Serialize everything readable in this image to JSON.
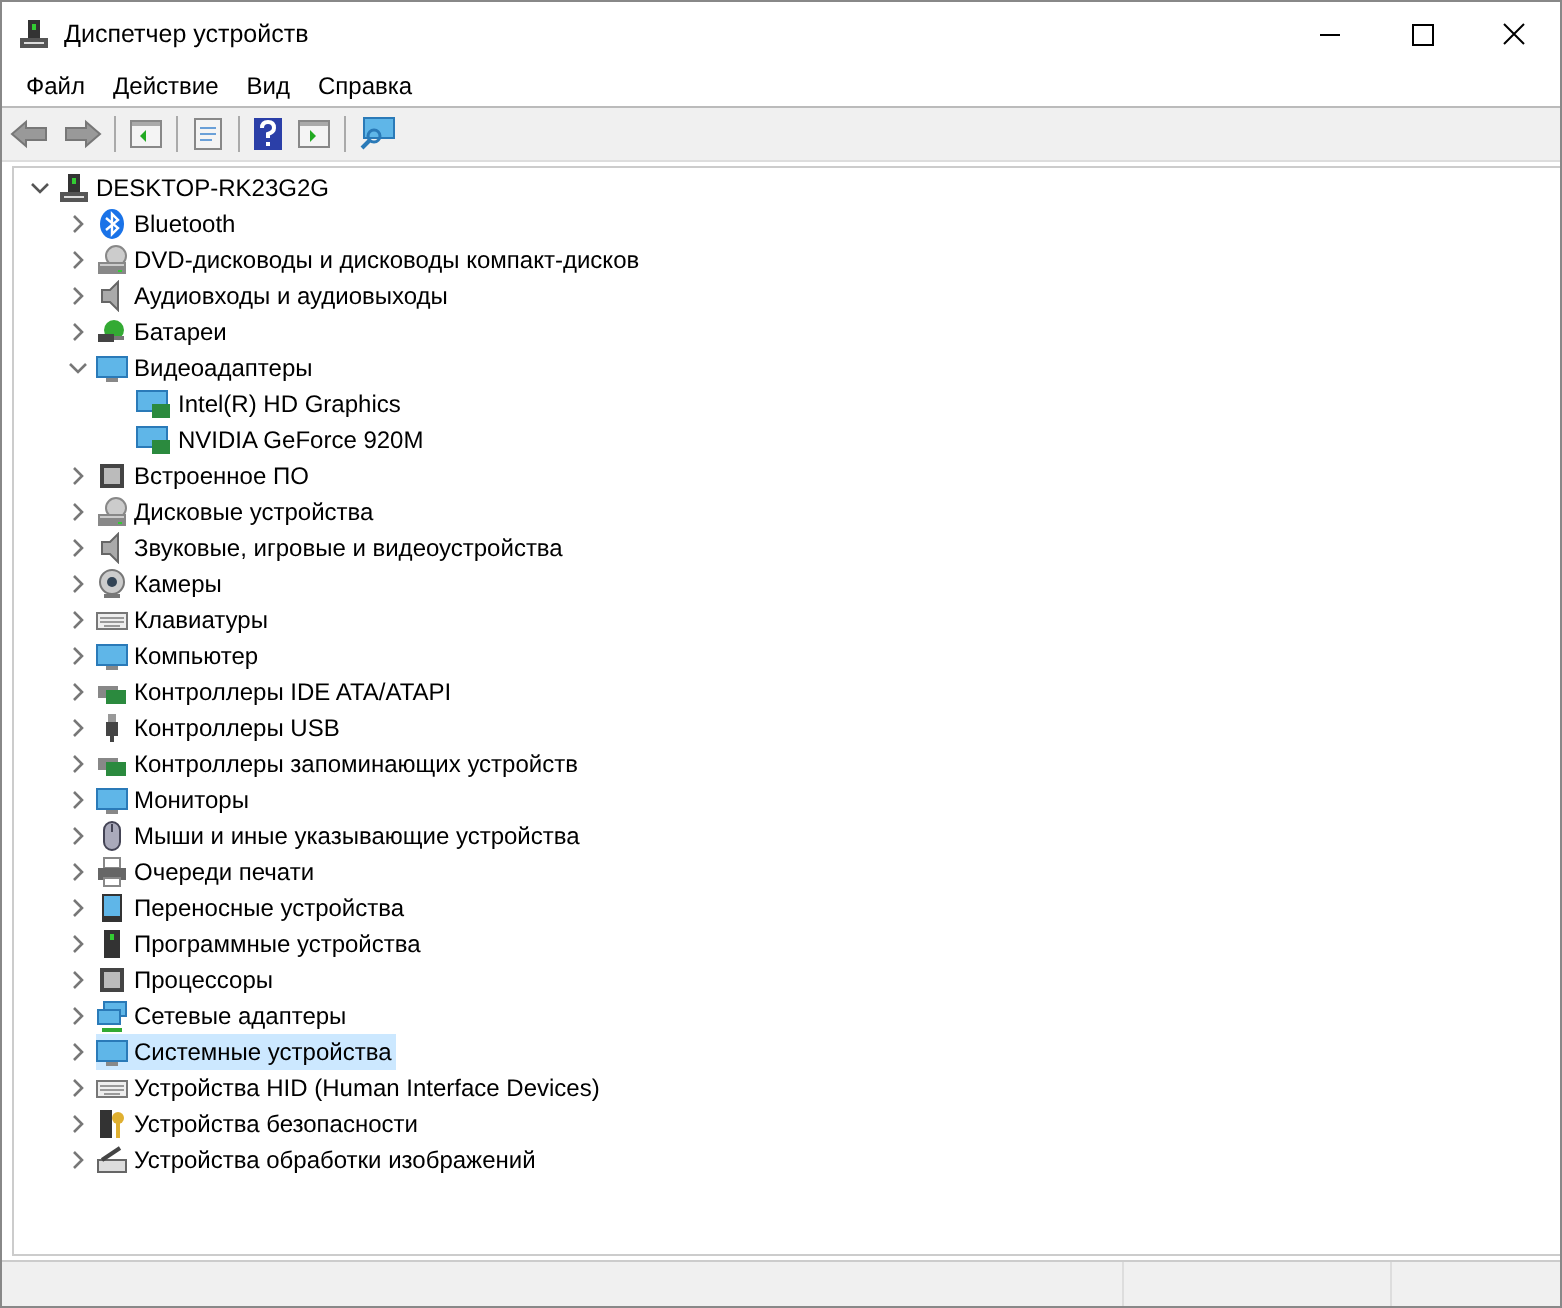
{
  "window": {
    "title": "Диспетчер устройств"
  },
  "menu": [
    "Файл",
    "Действие",
    "Вид",
    "Справка"
  ],
  "tree": {
    "label": "DESKTOP-RK23G2G",
    "expanded": true,
    "children": [
      {
        "label": "Bluetooth",
        "expanded": false,
        "selected": false
      },
      {
        "label": "DVD-дисководы и дисководы компакт-дисков",
        "expanded": false,
        "selected": false
      },
      {
        "label": "Аудиовходы и аудиовыходы",
        "expanded": false,
        "selected": false
      },
      {
        "label": "Батареи",
        "expanded": false,
        "selected": false
      },
      {
        "label": "Видеоадаптеры",
        "expanded": true,
        "selected": false,
        "children": [
          {
            "label": "Intel(R) HD Graphics",
            "selected": false
          },
          {
            "label": "NVIDIA GeForce 920M",
            "selected": false
          }
        ]
      },
      {
        "label": "Встроенное ПО",
        "expanded": false,
        "selected": false
      },
      {
        "label": "Дисковые устройства",
        "expanded": false,
        "selected": false
      },
      {
        "label": "Звуковые, игровые и видеоустройства",
        "expanded": false,
        "selected": false
      },
      {
        "label": "Камеры",
        "expanded": false,
        "selected": false
      },
      {
        "label": "Клавиатуры",
        "expanded": false,
        "selected": false
      },
      {
        "label": "Компьютер",
        "expanded": false,
        "selected": false
      },
      {
        "label": "Контроллеры IDE ATA/ATAPI",
        "expanded": false,
        "selected": false
      },
      {
        "label": "Контроллеры USB",
        "expanded": false,
        "selected": false
      },
      {
        "label": "Контроллеры запоминающих устройств",
        "expanded": false,
        "selected": false
      },
      {
        "label": "Мониторы",
        "expanded": false,
        "selected": false
      },
      {
        "label": "Мыши и иные указывающие устройства",
        "expanded": false,
        "selected": false
      },
      {
        "label": "Очереди печати",
        "expanded": false,
        "selected": false
      },
      {
        "label": "Переносные устройства",
        "expanded": false,
        "selected": false
      },
      {
        "label": "Программные устройства",
        "expanded": false,
        "selected": false
      },
      {
        "label": "Процессоры",
        "expanded": false,
        "selected": false
      },
      {
        "label": "Сетевые адаптеры",
        "expanded": false,
        "selected": false
      },
      {
        "label": "Системные устройства",
        "expanded": false,
        "selected": true
      },
      {
        "label": "Устройства HID (Human Interface Devices)",
        "expanded": false,
        "selected": false
      },
      {
        "label": "Устройства безопасности",
        "expanded": false,
        "selected": false
      },
      {
        "label": "Устройства обработки изображений",
        "expanded": false,
        "selected": false
      }
    ]
  }
}
